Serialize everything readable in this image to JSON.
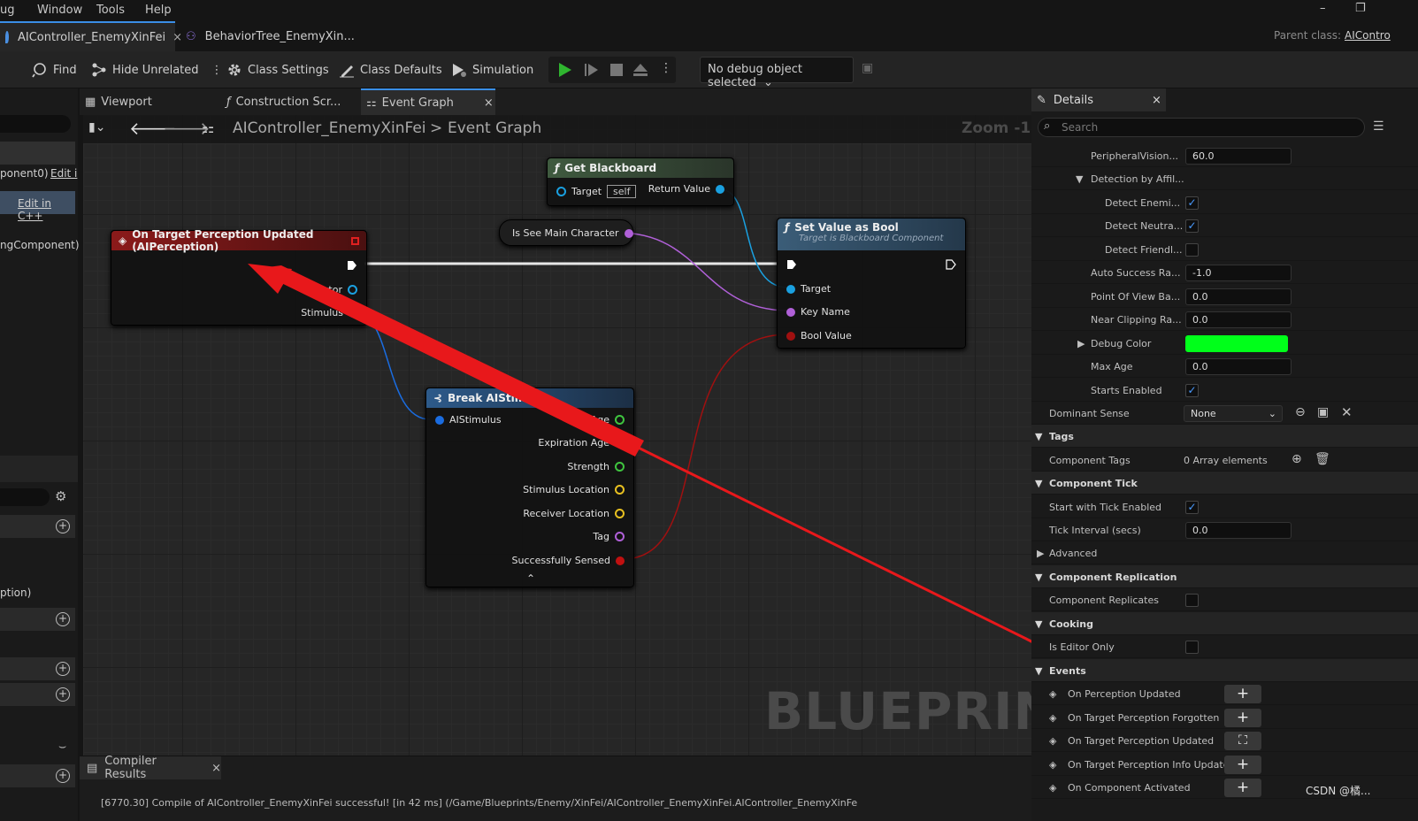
{
  "menu": {
    "items": [
      "ug",
      "Window",
      "Tools",
      "Help"
    ]
  },
  "window": {
    "minimize": "–",
    "restore": "❐"
  },
  "tabs": {
    "tab1": "AIController_EnemyXinFei",
    "tab1_close": "×",
    "tab2": "BehaviorTree_EnemyXin...",
    "parent_class_label": "Parent class:",
    "parent_class_value": "AIContro"
  },
  "toolbar": {
    "find": "Find",
    "hide_unrelated": "Hide Unrelated",
    "class_settings": "Class Settings",
    "class_defaults": "Class Defaults",
    "simulation": "Simulation",
    "debug_select": "No debug object selected"
  },
  "left": {
    "lines": [
      "ponent0)",
      "Edit i",
      "Edit in C++",
      "ngComponent)",
      "ption)"
    ]
  },
  "graph_tabs": {
    "viewport": "Viewport",
    "construction": "Construction Scr...",
    "event_graph": "Event Graph",
    "close": "×"
  },
  "breadcrumb": {
    "root": "AIController_EnemyXinFei",
    "sep": ">",
    "leaf": "Event Graph",
    "zoom": "Zoom -1"
  },
  "nodes": {
    "event": {
      "title": "On Target Perception Updated (AIPerception)",
      "pin_actor": "Actor",
      "pin_stimulus": "Stimulus"
    },
    "get_blackboard": {
      "title": "Get Blackboard",
      "pin_target": "Target",
      "self": "self",
      "pin_return": "Return Value"
    },
    "is_see": {
      "title": "Is See Main Character"
    },
    "set_value": {
      "title": "Set Value as Bool",
      "subtitle": "Target is Blackboard Component",
      "pin_target": "Target",
      "pin_key": "Key Name",
      "pin_bool": "Bool Value"
    },
    "break": {
      "title": "Break AIStimulus",
      "pin_in": "AIStimulus",
      "outs": [
        "Age",
        "Expiration Age",
        "Strength",
        "Stimulus Location",
        "Receiver Location",
        "Tag",
        "Successfully Sensed"
      ],
      "collapse": "⌃"
    }
  },
  "watermark": "BLUEPRINT",
  "compiler": {
    "title": "Compiler Results",
    "close": "×",
    "line": "[6770.30] Compile of AIController_EnemyXinFei successful! [in 42 ms] (/Game/Blueprints/Enemy/XinFei/AIController_EnemyXinFei.AIController_EnemyXinFe"
  },
  "details": {
    "title": "Details",
    "close": "×",
    "search_placeholder": "Search",
    "rows": {
      "peripheral": {
        "label": "PeripheralVision...",
        "value": "60.0"
      },
      "detection": {
        "label": "Detection by Affil..."
      },
      "enemies": {
        "label": "Detect Enemi..."
      },
      "neutrals": {
        "label": "Detect Neutra..."
      },
      "friendlies": {
        "label": "Detect Friendl..."
      },
      "auto_success": {
        "label": "Auto Success Ra...",
        "value": "-1.0"
      },
      "pov": {
        "label": "Point Of View Ba...",
        "value": "0.0"
      },
      "near_clip": {
        "label": "Near Clipping Ra...",
        "value": "0.0"
      },
      "debug_color": {
        "label": "Debug Color",
        "color": "#00ff1a"
      },
      "max_age": {
        "label": "Max Age",
        "value": "0.0"
      },
      "starts_enabled": {
        "label": "Starts Enabled"
      },
      "dominant": {
        "label": "Dominant Sense",
        "value": "None"
      },
      "tags": {
        "label": "Tags"
      },
      "component_tags": {
        "label": "Component Tags",
        "value": "0 Array elements"
      },
      "component_tick": {
        "label": "Component Tick"
      },
      "start_tick": {
        "label": "Start with Tick Enabled"
      },
      "tick_interval": {
        "label": "Tick Interval (secs)",
        "value": "0.0"
      },
      "advanced": {
        "label": "Advanced"
      },
      "replication": {
        "label": "Component Replication"
      },
      "replicates": {
        "label": "Component Replicates"
      },
      "cooking": {
        "label": "Cooking"
      },
      "editor_only": {
        "label": "Is Editor Only"
      },
      "events": {
        "label": "Events"
      },
      "ev1": {
        "label": "On Perception Updated"
      },
      "ev2": {
        "label": "On Target Perception Forgotten"
      },
      "ev3": {
        "label": "On Target Perception Updated"
      },
      "ev4": {
        "label": "On Target Perception Info Updated"
      },
      "ev5": {
        "label": "On Component Activated"
      }
    },
    "plus": "+",
    "check": "✓",
    "watermark": "CSDN @橘..."
  },
  "colors": {
    "accent": "#3a8ee6",
    "event_red": "#8b1a1a",
    "function_blue": "#3b5d78",
    "arrow_red": "#e8181b"
  }
}
